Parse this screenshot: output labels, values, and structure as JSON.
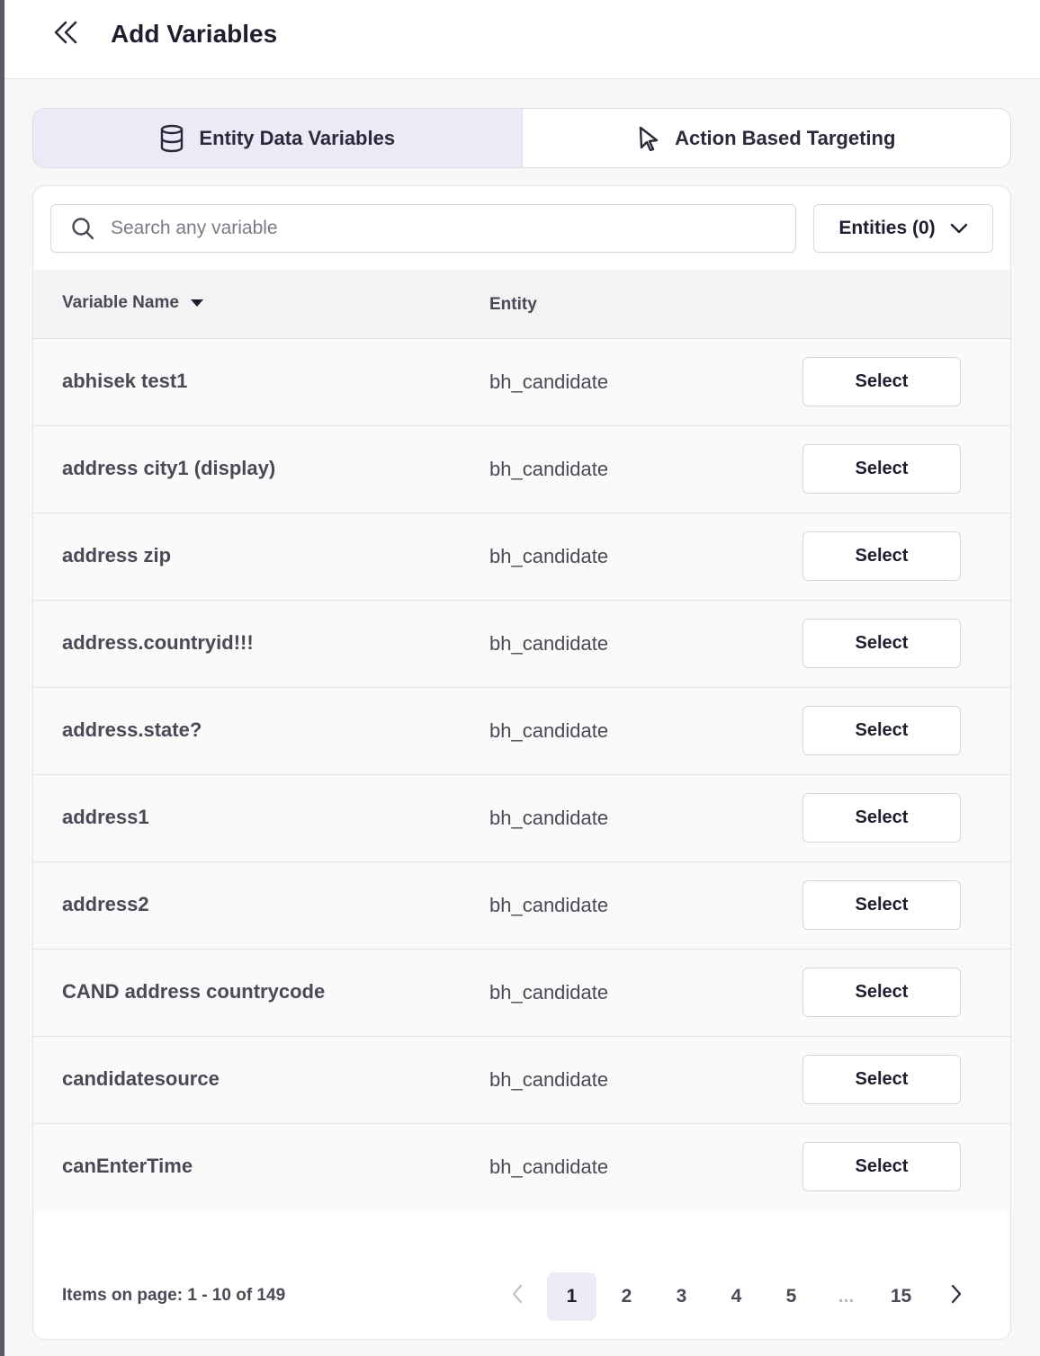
{
  "header": {
    "title": "Add Variables",
    "back_icon": "double-chevron-left-icon"
  },
  "tabs": [
    {
      "label": "Entity Data Variables",
      "icon": "database-icon",
      "active": true
    },
    {
      "label": "Action Based Targeting",
      "icon": "cursor-pointer-icon",
      "active": false
    }
  ],
  "search": {
    "placeholder": "Search any variable",
    "value": ""
  },
  "filter": {
    "label": "Entities (0)"
  },
  "table": {
    "columns": [
      "Variable Name",
      "Entity"
    ],
    "sort_column": "Variable Name",
    "sort_direction": "descending",
    "select_label": "Select",
    "rows": [
      {
        "name": "abhisek test1",
        "entity": "bh_candidate"
      },
      {
        "name": "address city1 (display)",
        "entity": "bh_candidate"
      },
      {
        "name": "address zip",
        "entity": "bh_candidate"
      },
      {
        "name": "address.countryid!!!",
        "entity": "bh_candidate"
      },
      {
        "name": "address.state?",
        "entity": "bh_candidate"
      },
      {
        "name": "address1",
        "entity": "bh_candidate"
      },
      {
        "name": "address2",
        "entity": "bh_candidate"
      },
      {
        "name": "CAND address countrycode",
        "entity": "bh_candidate"
      },
      {
        "name": "candidatesource",
        "entity": "bh_candidate"
      },
      {
        "name": "canEnterTime",
        "entity": "bh_candidate"
      }
    ]
  },
  "pagination": {
    "info": "Items on page: 1 - 10 of 149",
    "pages": [
      "1",
      "2",
      "3",
      "4",
      "5",
      "...",
      "15"
    ],
    "current": "1"
  },
  "colors": {
    "accent_bg": "#ebeaf6",
    "text_dark": "#1f1e2e",
    "text_muted": "#4a4956"
  }
}
